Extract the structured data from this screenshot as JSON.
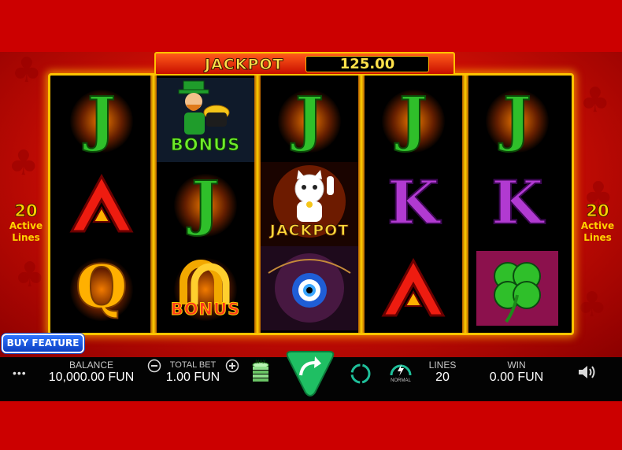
{
  "jackpot": {
    "label": "JACKPOT",
    "value": "125.00"
  },
  "reels": [
    [
      "J",
      "A",
      "Q"
    ],
    [
      "leprechaun-bonus",
      "J",
      "horseshoe-bonus"
    ],
    [
      "J",
      "lucky-cat-jackpot",
      "evil-eye"
    ],
    [
      "J",
      "K",
      "A"
    ],
    [
      "J",
      "K",
      "four-leaf-clover"
    ]
  ],
  "symbol_captions": {
    "bonus": "BONUS",
    "jackpot": "JACKPOT"
  },
  "active_lines": {
    "count": "20",
    "label_line1": "Active",
    "label_line2": "Lines"
  },
  "buy_feature_label": "BUY FEATURE",
  "controls": {
    "menu_glyph": "•••",
    "balance_label": "BALANCE",
    "balance_value": "10,000.00 FUN",
    "total_bet_label": "TOTAL BET",
    "total_bet_value": "1.00 FUN",
    "max_chip_label": "MAX",
    "speed_label": "NORMAL",
    "lines_label": "LINES",
    "lines_value": "20",
    "win_label": "WIN",
    "win_value": "0.00 FUN"
  },
  "colors": {
    "background_red": "#cc0000",
    "frame_gold": "#ffc400",
    "spin_green": "#1fbf63",
    "buy_feature_blue": "#1f5cf0",
    "letter_j": "#2fbf2a",
    "letter_k": "#b13ad1",
    "letter_q": "#ffb000",
    "letter_a": "#ee1c10"
  },
  "icons": [
    "menu-icon",
    "minus-icon",
    "plus-icon",
    "max-bet-icon",
    "spin-icon",
    "autoplay-icon",
    "speed-icon",
    "sound-icon"
  ]
}
